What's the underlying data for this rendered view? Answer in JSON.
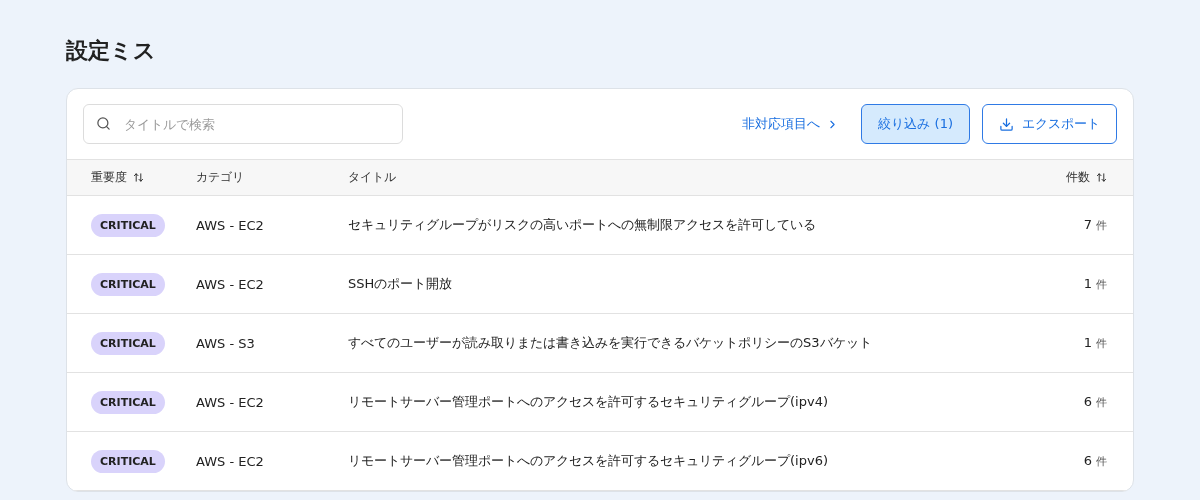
{
  "page_title": "設定ミス",
  "search": {
    "placeholder": "タイトルで検索"
  },
  "link": {
    "label": "非対応項目へ"
  },
  "filter_button": {
    "label": "絞り込み (1)",
    "active": true
  },
  "export_button": {
    "label": "エクスポート"
  },
  "table": {
    "columns": [
      {
        "label": "重要度",
        "sortable": true
      },
      {
        "label": "カテゴリ",
        "sortable": false
      },
      {
        "label": "タイトル",
        "sortable": false
      },
      {
        "label": "件数",
        "sortable": true
      }
    ],
    "rows": [
      {
        "severity": "CRITICAL",
        "category": "AWS - EC2",
        "title": "セキュリティグループがリスクの高いポートへの無制限アクセスを許可している",
        "count": "7",
        "unit": "件"
      },
      {
        "severity": "CRITICAL",
        "category": "AWS - EC2",
        "title": "SSHのポート開放",
        "count": "1",
        "unit": "件"
      },
      {
        "severity": "CRITICAL",
        "category": "AWS - S3",
        "title": "すべてのユーザーが読み取りまたは書き込みを実行できるバケットポリシーのS3バケット",
        "count": "1",
        "unit": "件"
      },
      {
        "severity": "CRITICAL",
        "category": "AWS - EC2",
        "title": "リモートサーバー管理ポートへのアクセスを許可するセキュリティグループ(ipv4)",
        "count": "6",
        "unit": "件"
      },
      {
        "severity": "CRITICAL",
        "category": "AWS - EC2",
        "title": "リモートサーバー管理ポートへのアクセスを許可するセキュリティグループ(ipv6)",
        "count": "6",
        "unit": "件"
      }
    ]
  }
}
